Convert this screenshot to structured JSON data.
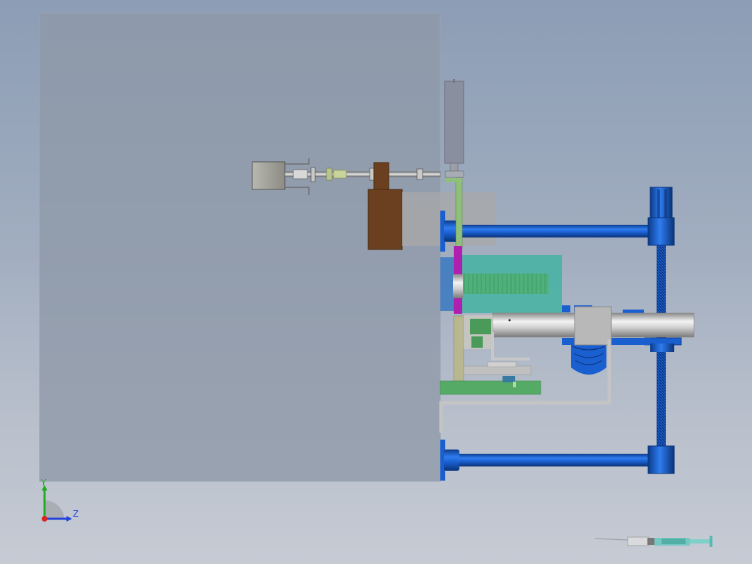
{
  "app": {
    "type": "CAD 3D assembly viewport"
  },
  "triad": {
    "y_label": "Y",
    "z_label": "Z",
    "y_color": "#22aa22",
    "z_color": "#2244dd",
    "x_color": "#dd2222"
  },
  "colors": {
    "background_top": "#8c9db5",
    "background_bottom": "#c6cbd4",
    "plate": "#8e98a8",
    "blue_part": "#1a5fd0",
    "brown_block": "#6a4020",
    "teal_block": "#3fb3a0",
    "green_plate": "#55aa66",
    "magenta_part": "#b020b0",
    "motor_gray": "#9aa0a8"
  },
  "icons": {
    "corner_logo": "syringe-icon",
    "triad": "coordinate-triad-icon"
  }
}
